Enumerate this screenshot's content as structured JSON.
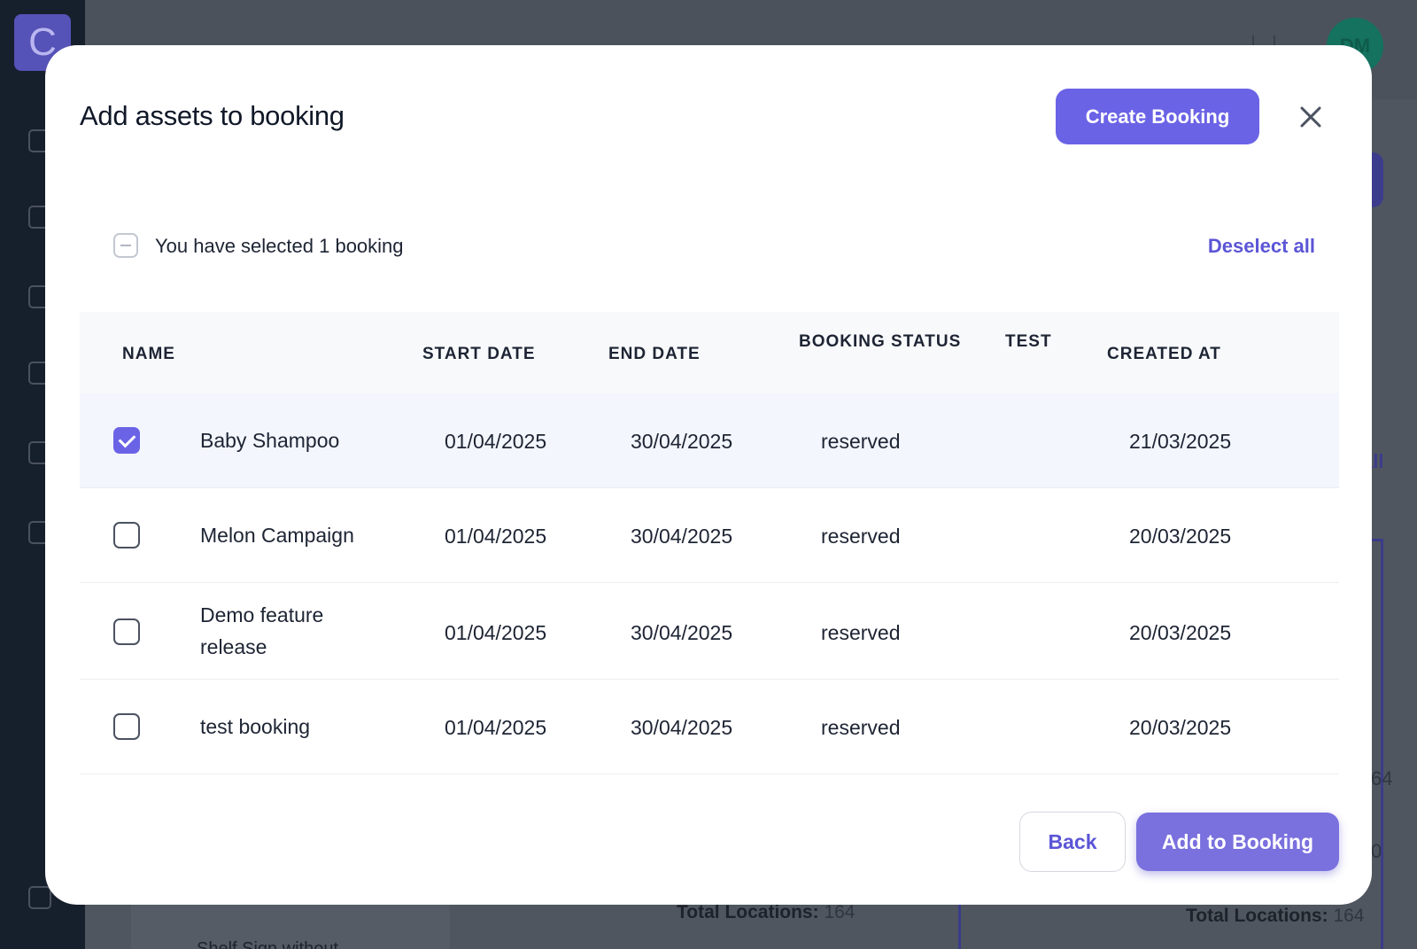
{
  "background": {
    "logo_letter": "C",
    "avatar_initials": "DM",
    "link_fragment": "all",
    "total_locations_label": "Total Locations:",
    "total_locations_value": "164",
    "card_text": "Shelf Sign without",
    "side_number_1": "64",
    "side_number_2": "0"
  },
  "modal": {
    "title": "Add assets to booking",
    "create_button": "Create Booking",
    "selection_text": "You have selected 1 booking",
    "deselect_all": "Deselect all",
    "back_button": "Back",
    "add_button": "Add to Booking"
  },
  "table": {
    "columns": {
      "name": "NAME",
      "start_date": "START DATE",
      "end_date": "END DATE",
      "booking_status": "BOOKING STATUS",
      "test": "TEST",
      "created_at": "CREATED AT"
    },
    "rows": [
      {
        "name": "Baby Shampoo",
        "start": "01/04/2025",
        "end": "30/04/2025",
        "status": "reserved",
        "test": "",
        "created": "21/03/2025",
        "checked": true
      },
      {
        "name": "Melon Campaign",
        "start": "01/04/2025",
        "end": "30/04/2025",
        "status": "reserved",
        "test": "",
        "created": "20/03/2025",
        "checked": false
      },
      {
        "name": "Demo feature release",
        "start": "01/04/2025",
        "end": "30/04/2025",
        "status": "reserved",
        "test": "",
        "created": "20/03/2025",
        "checked": false
      },
      {
        "name": "test booking",
        "start": "01/04/2025",
        "end": "30/04/2025",
        "status": "reserved",
        "test": "",
        "created": "20/03/2025",
        "checked": false
      }
    ]
  },
  "colors": {
    "accent": "#6b63e6",
    "overlay": "#4f5660",
    "sidebar": "#161f2c"
  }
}
